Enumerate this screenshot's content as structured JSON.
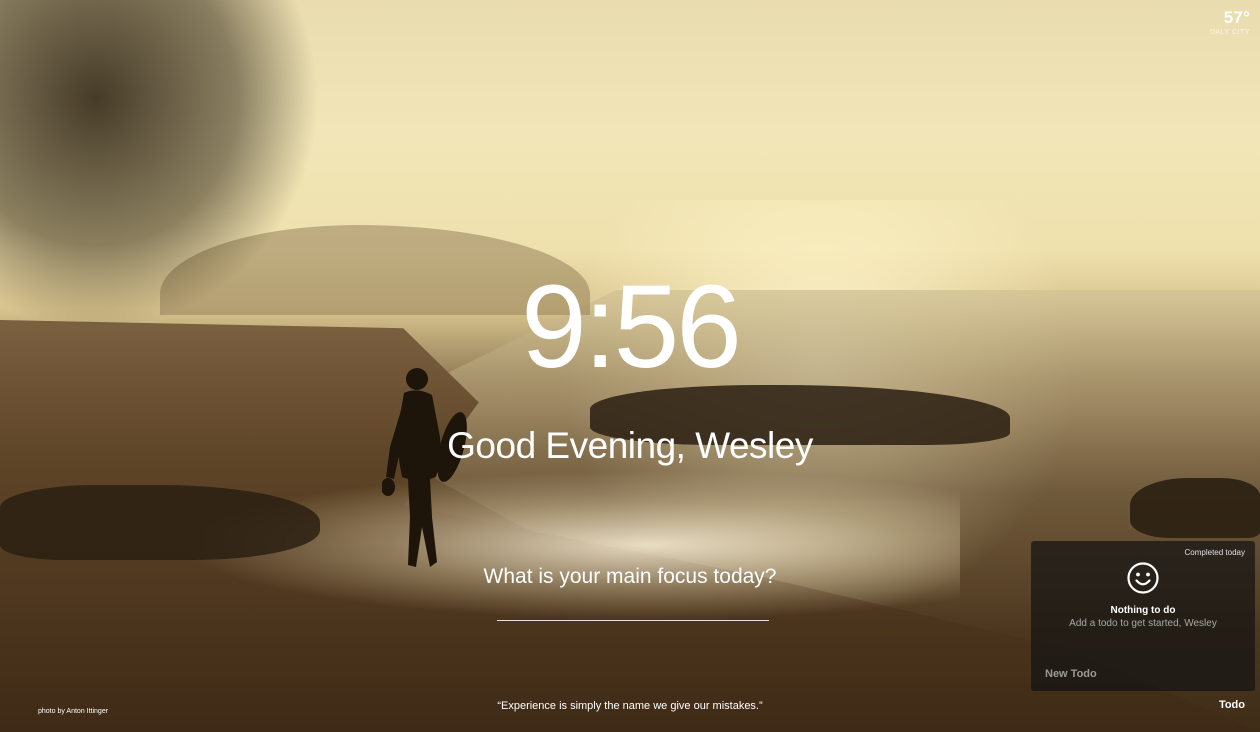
{
  "weather": {
    "temperature": "57°",
    "location": "DALY CITY"
  },
  "clock": {
    "time": "9:56"
  },
  "greeting": {
    "text": "Good Evening, Wesley"
  },
  "focus": {
    "question": "What is your main focus today?",
    "input_value": ""
  },
  "quote": {
    "text": "“Experience is simply the name we give our mistakes.”"
  },
  "photo_credit": {
    "text": "photo by Anton Ittinger"
  },
  "todo": {
    "completed_label": "Completed today",
    "icon": "smiley-icon",
    "empty_title": "Nothing to do",
    "empty_subtitle": "Add a todo to get started, Wesley",
    "new_placeholder": "New Todo",
    "toggle_label": "Todo"
  },
  "colors": {
    "text": "#ffffff",
    "panel_bg": "#141414"
  }
}
